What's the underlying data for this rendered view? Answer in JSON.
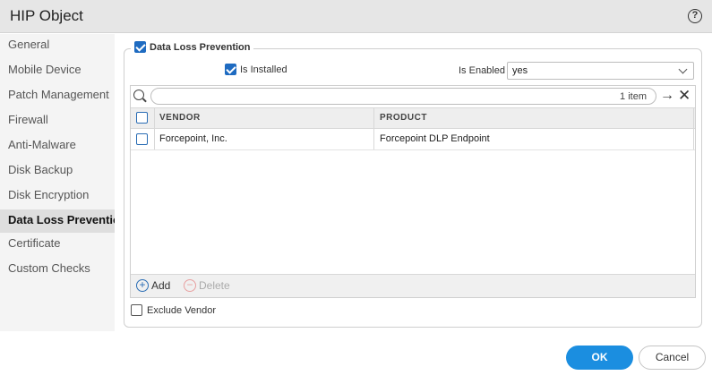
{
  "dialog": {
    "title": "HIP Object"
  },
  "sidebar": {
    "items": [
      {
        "label": "General"
      },
      {
        "label": "Mobile Device"
      },
      {
        "label": "Patch Management"
      },
      {
        "label": "Firewall"
      },
      {
        "label": "Anti-Malware"
      },
      {
        "label": "Disk Backup"
      },
      {
        "label": "Disk Encryption"
      },
      {
        "label": "Data Loss Prevention",
        "active": true
      },
      {
        "label": "Certificate"
      },
      {
        "label": "Custom Checks"
      }
    ]
  },
  "section": {
    "legend": "Data Loss Prevention",
    "enabled_checkbox": true,
    "is_installed_label": "Is Installed",
    "is_installed": true,
    "is_enabled_label": "Is Enabled",
    "is_enabled_value": "yes"
  },
  "grid": {
    "search_value": "",
    "item_count": "1 item",
    "columns": [
      "VENDOR",
      "PRODUCT"
    ],
    "rows": [
      {
        "vendor": "Forcepoint, Inc.",
        "product": "Forcepoint DLP Endpoint"
      }
    ],
    "add_label": "Add",
    "delete_label": "Delete"
  },
  "exclude_vendor_label": "Exclude Vendor",
  "buttons": {
    "ok": "OK",
    "cancel": "Cancel"
  },
  "colors": {
    "accent": "#1b8ee0",
    "checkbox": "#1e6bc1"
  }
}
